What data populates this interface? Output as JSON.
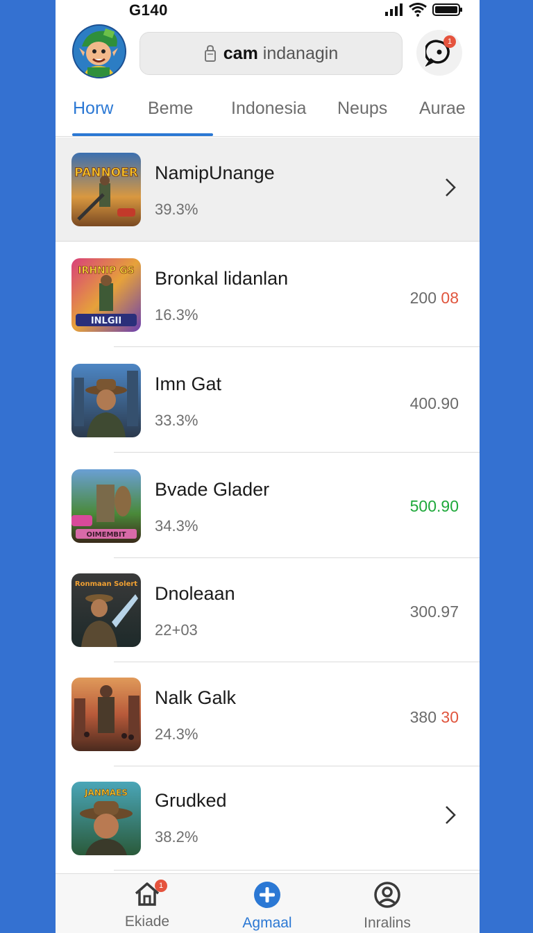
{
  "status_bar": {
    "time": "G140"
  },
  "header": {
    "search_bold": "cam",
    "search_rest": "indanagin",
    "chat_badge": "1"
  },
  "tabs": [
    {
      "label": "Horw",
      "active": true
    },
    {
      "label": "Beme",
      "active": false
    },
    {
      "label": "Indonesia",
      "active": false
    },
    {
      "label": "Neups",
      "active": false
    },
    {
      "label": "Aurae",
      "active": false
    }
  ],
  "list": [
    {
      "thumb_text": "PANNOER",
      "name": "NamipUnange",
      "pct": "39.3%",
      "value": "",
      "trailing": "chevron"
    },
    {
      "thumb_text": "IRHNIP GS",
      "thumb_text_2": "INLGII",
      "name": "Bronkal lidanlan",
      "pct": "16.3%",
      "value_a": "200",
      "value_b": "08"
    },
    {
      "thumb_text": "",
      "name": "Imn Gat",
      "pct": "33.3%",
      "value": "400.90"
    },
    {
      "thumb_text": "OIMEMBIT",
      "name": "Bvade Glader",
      "pct": "34.3%",
      "value": "500.90",
      "value_color": "#1ea83a"
    },
    {
      "thumb_text": "Ronmaan Solert",
      "name": "Dnoleaan",
      "pct": "22+03",
      "value": "300.97"
    },
    {
      "thumb_text": "",
      "name": "Nalk Galk",
      "pct": "24.3%",
      "value_a": "380",
      "value_b": "30"
    },
    {
      "thumb_text": "JANMAES",
      "name": "Grudked",
      "pct": "38.2%",
      "value": "",
      "trailing": "chevron"
    }
  ],
  "bottom_nav": [
    {
      "label": "Ekiade",
      "icon": "home-icon",
      "badge": "1",
      "active": false
    },
    {
      "label": "Agmaal",
      "icon": "add-circle-icon",
      "active": true
    },
    {
      "label": "Inralins",
      "icon": "profile-icon",
      "active": false
    }
  ],
  "colors": {
    "accent": "#2b78d4",
    "background": "#3471d1",
    "positive": "#1ea83a",
    "negative": "#e0553d"
  }
}
